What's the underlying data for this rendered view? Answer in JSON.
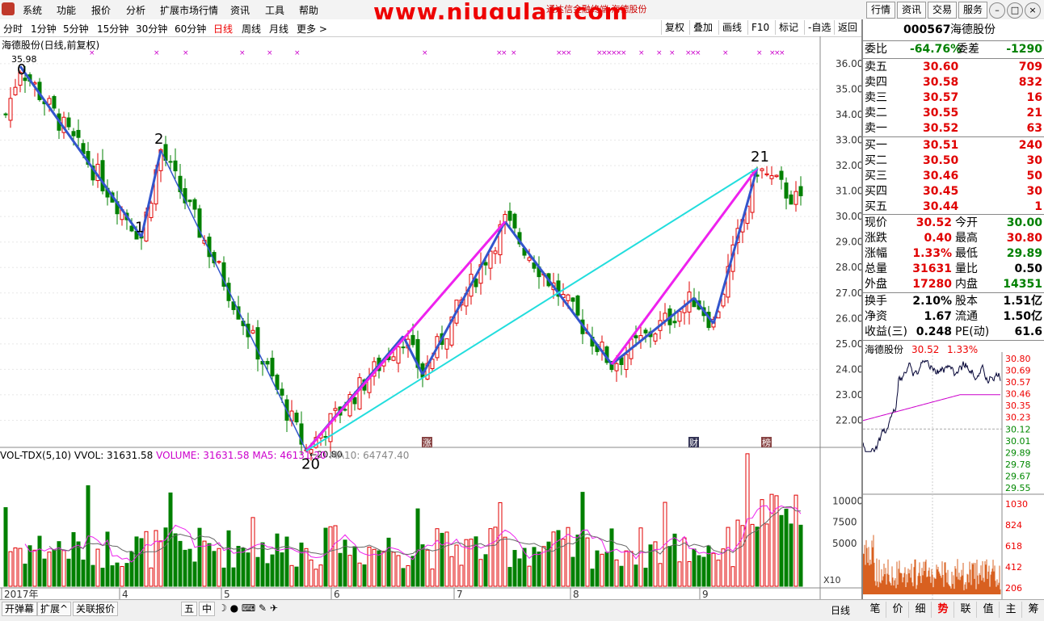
{
  "menu": {
    "items": [
      "系统",
      "功能",
      "报价",
      "分析",
      "扩展市场行情",
      "资讯",
      "工具",
      "帮助"
    ],
    "watermark": "www.niugulan.com",
    "title_text": "通达信金融终端   海德股份",
    "right_buttons": [
      "行情",
      "资讯",
      "交易",
      "服务"
    ]
  },
  "toolbar": {
    "periods": [
      "分时",
      "1分钟",
      "5分钟",
      "15分钟",
      "30分钟",
      "60分钟",
      "日线",
      "周线",
      "月线",
      "更多 >"
    ],
    "active_period": "日线",
    "tools": [
      "复权",
      "叠加",
      "画线",
      "F10",
      "标记",
      "-自选",
      "返回"
    ]
  },
  "chart": {
    "title": "海德股份(日线,前复权)",
    "high_marker": "35.98",
    "low_marker": "←20.80",
    "wave_labels": [
      "0",
      "1",
      "2",
      "20",
      "21"
    ],
    "event_tags": [
      "涨",
      "财",
      "榜"
    ],
    "price_ticks": [
      "36.00",
      "35.00",
      "34.00",
      "33.00",
      "32.00",
      "31.00",
      "30.00",
      "29.00",
      "28.00",
      "27.00",
      "26.00",
      "25.00",
      "24.00",
      "23.00",
      "22.00"
    ],
    "vol_ticks": [
      "10000",
      "7500",
      "5000"
    ],
    "vol_unit": "X10",
    "date_labels": [
      "2017年",
      "4",
      "5",
      "6",
      "7",
      "8",
      "9"
    ]
  },
  "chart_data": {
    "type": "candlestick",
    "title": "海德股份(日线,前复权)",
    "ylim": [
      21,
      36.6
    ],
    "high": 35.98,
    "low": 20.8,
    "wave_points": [
      {
        "label": "0",
        "value": 35.98
      },
      {
        "label": "1",
        "value": 29.2
      },
      {
        "label": "2",
        "value": 32.6
      },
      {
        "label": "20",
        "value": 20.8
      },
      {
        "label": "21",
        "value": 31.9
      }
    ],
    "volume_indicator": {
      "name": "VOL-TDX(5,10)",
      "vvol": "31631.58",
      "volume": "31631.58",
      "ma5": "46131.20",
      "ma10": "64747.40"
    }
  },
  "vol_header": {
    "name": "VOL-TDX(5,10)",
    "vvol": "VVOL: 31631.58",
    "volume": "VOLUME: 31631.58",
    "ma5": "MA5: 46131.20",
    "ma10": "MA10: 64747.40"
  },
  "status_bar": {
    "buttons": [
      "开弹幕",
      "扩展^",
      "关联报价"
    ],
    "period": "日线",
    "icons": [
      "五",
      "中"
    ]
  },
  "quote": {
    "code": "000567",
    "name": "海德股份",
    "weibi_label": "委比",
    "weibi_value": "-64.76%",
    "weicha_label": "委差",
    "weicha_value": "-1290",
    "sell": [
      {
        "label": "卖五",
        "price": "30.60",
        "vol": "709"
      },
      {
        "label": "卖四",
        "price": "30.58",
        "vol": "832"
      },
      {
        "label": "卖三",
        "price": "30.57",
        "vol": "16"
      },
      {
        "label": "卖二",
        "price": "30.55",
        "vol": "21"
      },
      {
        "label": "卖一",
        "price": "30.52",
        "vol": "63"
      }
    ],
    "buy": [
      {
        "label": "买一",
        "price": "30.51",
        "vol": "240"
      },
      {
        "label": "买二",
        "price": "30.50",
        "vol": "30"
      },
      {
        "label": "买三",
        "price": "30.46",
        "vol": "50"
      },
      {
        "label": "买四",
        "price": "30.45",
        "vol": "30"
      },
      {
        "label": "买五",
        "price": "30.44",
        "vol": "1"
      }
    ],
    "stats": [
      {
        "l1": "现价",
        "v1": "30.52",
        "l2": "今开",
        "v2": "30.00"
      },
      {
        "l1": "涨跌",
        "v1": "0.40",
        "l2": "最高",
        "v2": "30.80"
      },
      {
        "l1": "涨幅",
        "v1": "1.33%",
        "l2": "最低",
        "v2": "29.89"
      },
      {
        "l1": "总量",
        "v1": "31631",
        "l2": "量比",
        "v2": "0.50"
      },
      {
        "l1": "外盘",
        "v1": "17280",
        "l2": "内盘",
        "v2": "14351"
      }
    ],
    "fund": [
      {
        "l1": "换手",
        "v1": "2.10%",
        "l2": "股本",
        "v2": "1.51亿"
      },
      {
        "l1": "净资",
        "v1": "1.67",
        "l2": "流通",
        "v2": "1.50亿"
      },
      {
        "l1": "收益(三)",
        "v1": "0.248",
        "l2": "PE(动)",
        "v2": "61.6"
      }
    ],
    "mini_title": "海德股份",
    "mini_price": "30.52",
    "mini_pct": "1.33%",
    "mini_ticks": [
      "30.80",
      "30.69",
      "30.57",
      "30.46",
      "30.35",
      "30.23",
      "30.12",
      "30.01",
      "29.89",
      "29.78",
      "29.67",
      "29.55"
    ],
    "mini_vol_ticks": [
      "1030",
      "824",
      "618",
      "412",
      "206"
    ],
    "tabs": [
      "笔",
      "价",
      "细",
      "势",
      "联",
      "值",
      "主",
      "筹"
    ],
    "active_tab": "势"
  },
  "colors": {
    "up": "#e00000",
    "down": "#008000",
    "wave": "#3355cc",
    "magenta": "#ee22ee",
    "cyan": "#22dddd"
  }
}
